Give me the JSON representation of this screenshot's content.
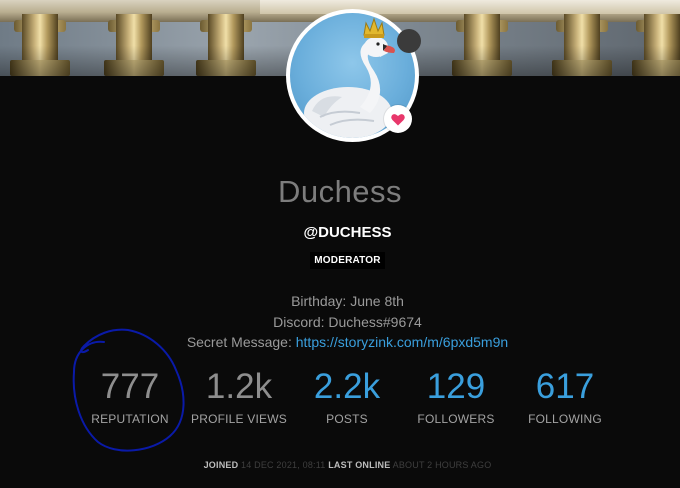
{
  "profile": {
    "display_name": "Duchess",
    "handle": "@DUCHESS",
    "badge": "MODERATOR",
    "status_color": "#3b3b3b",
    "heart_color": "#e8376b"
  },
  "fields": {
    "birthday": "Birthday: June 8th",
    "discord": "Discord: Duchess#9674",
    "secret_label": "Secret Message: ",
    "secret_link": "https://storyzink.com/m/6pxd5m9n"
  },
  "stats": [
    {
      "value": "777",
      "label": "REPUTATION"
    },
    {
      "value": "1.2k",
      "label": "PROFILE VIEWS"
    },
    {
      "value": "2.2k",
      "label": "POSTS"
    },
    {
      "value": "129",
      "label": "FOLLOWERS"
    },
    {
      "value": "617",
      "label": "FOLLOWING"
    }
  ],
  "footer": {
    "joined_label": "JOINED",
    "joined_value": "14 DEC 2021, 08:11",
    "online_label": "LAST ONLINE",
    "online_value": "ABOUT 2 HOURS AGO"
  },
  "colors": {
    "accent_blue": "#3a9fdd",
    "background": "#0a0a0a",
    "annotation_ink": "#0a1aa8"
  }
}
